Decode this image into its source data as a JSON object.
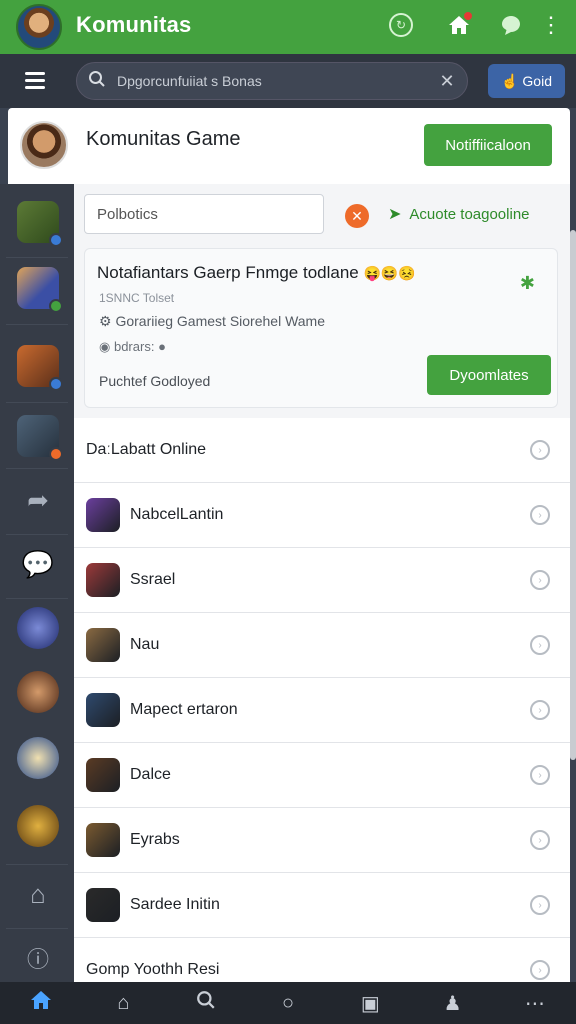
{
  "app": {
    "title": "Komunitas"
  },
  "search": {
    "placeholder": "Dpgorcunfuiiat s Bonas",
    "button_label": "Goid"
  },
  "profile": {
    "title": "Komunitas Game",
    "button_label": "Notiffiicaloon"
  },
  "filter": {
    "value": "Polbotics",
    "activate_label": "Acuote toagooline"
  },
  "notice": {
    "title": "Notafiantars Gaerp Fnmge todlane",
    "emoji": "😝😆😣",
    "meta": "1SNNC Tolset",
    "description": "Gorariieg Gamest Siorehel Wame",
    "tag": "bdrars:",
    "footer": "Puchtef Godloyed",
    "button_label": "Dyoomlates"
  },
  "list": [
    {
      "label": "DaːLabatt Online",
      "icon": null
    },
    {
      "label": "NabcelLantin",
      "icon": "#6b3f9e"
    },
    {
      "label": "Ssrael",
      "icon": "#9c3a3a"
    },
    {
      "label": "Nau",
      "icon": "#8a6a42"
    },
    {
      "label": "Mapect ertaron",
      "icon": "#2f4a6e"
    },
    {
      "label": "Dalce",
      "icon": "#5a3b24"
    },
    {
      "label": "Eyrabs",
      "icon": "#7a5a30"
    },
    {
      "label": "Sardee Initin",
      "icon": "#2a2a2a"
    },
    {
      "label": "Gomp Yoothh Resi",
      "icon": null
    }
  ],
  "rail_icons": [
    {
      "name": "rifle-game-icon",
      "color": "#4b6b2e",
      "badge": "#3a7bd5"
    },
    {
      "name": "soldier-game-icon",
      "color": "#3b4fa5",
      "badge": "#44a23f"
    },
    {
      "name": "warrior-game-icon",
      "color": "#a5532b",
      "badge": "#3a7bd5"
    },
    {
      "name": "gun-game-icon",
      "color": "#3f5367",
      "badge": "#ee6b2a"
    }
  ],
  "nav": [
    "home-icon",
    "house-outline-icon",
    "search-icon",
    "circle-icon",
    "bookmark-icon",
    "profile-icon",
    "more-icon"
  ],
  "colors": {
    "brand_green": "#44a23f",
    "accent_blue": "#3c64a6",
    "rail": "#363c47"
  }
}
